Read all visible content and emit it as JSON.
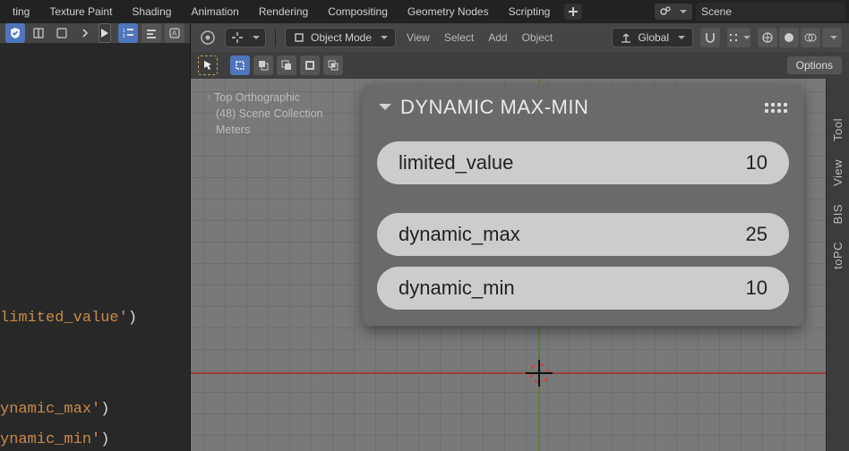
{
  "topbar": {
    "workspaces": [
      "ting",
      "Texture Paint",
      "Shading",
      "Animation",
      "Rendering",
      "Compositing",
      "Geometry Nodes",
      "Scripting"
    ],
    "scene_field": "Scene"
  },
  "text_editor": {
    "code_fragments": [
      {
        "fn": "",
        "str": "limited_value'",
        "suffix": ")"
      },
      {
        "spacer": true
      },
      {
        "fn": "",
        "str": "ynamic_max'",
        "suffix": ")"
      },
      {
        "fn": "",
        "str": "ynamic_min'",
        "suffix": ")"
      }
    ]
  },
  "viewport": {
    "mode": "Object Mode",
    "menus": [
      "View",
      "Select",
      "Add",
      "Object"
    ],
    "orientation": "Global",
    "toolrow_options": "Options",
    "overlay": {
      "view_name": "Top Orthographic",
      "collection": "(48) Scene Collection",
      "units": "Meters"
    },
    "side_tabs": [
      "Tool",
      "View",
      "BIS",
      "toPC"
    ]
  },
  "panel": {
    "title": "DYNAMIC MAX-MIN",
    "fields": [
      {
        "label": "limited_value",
        "value": "10",
        "gap": false
      },
      {
        "label": "dynamic_max",
        "value": "25",
        "gap": true
      },
      {
        "label": "dynamic_min",
        "value": "10",
        "gap": false
      }
    ]
  }
}
